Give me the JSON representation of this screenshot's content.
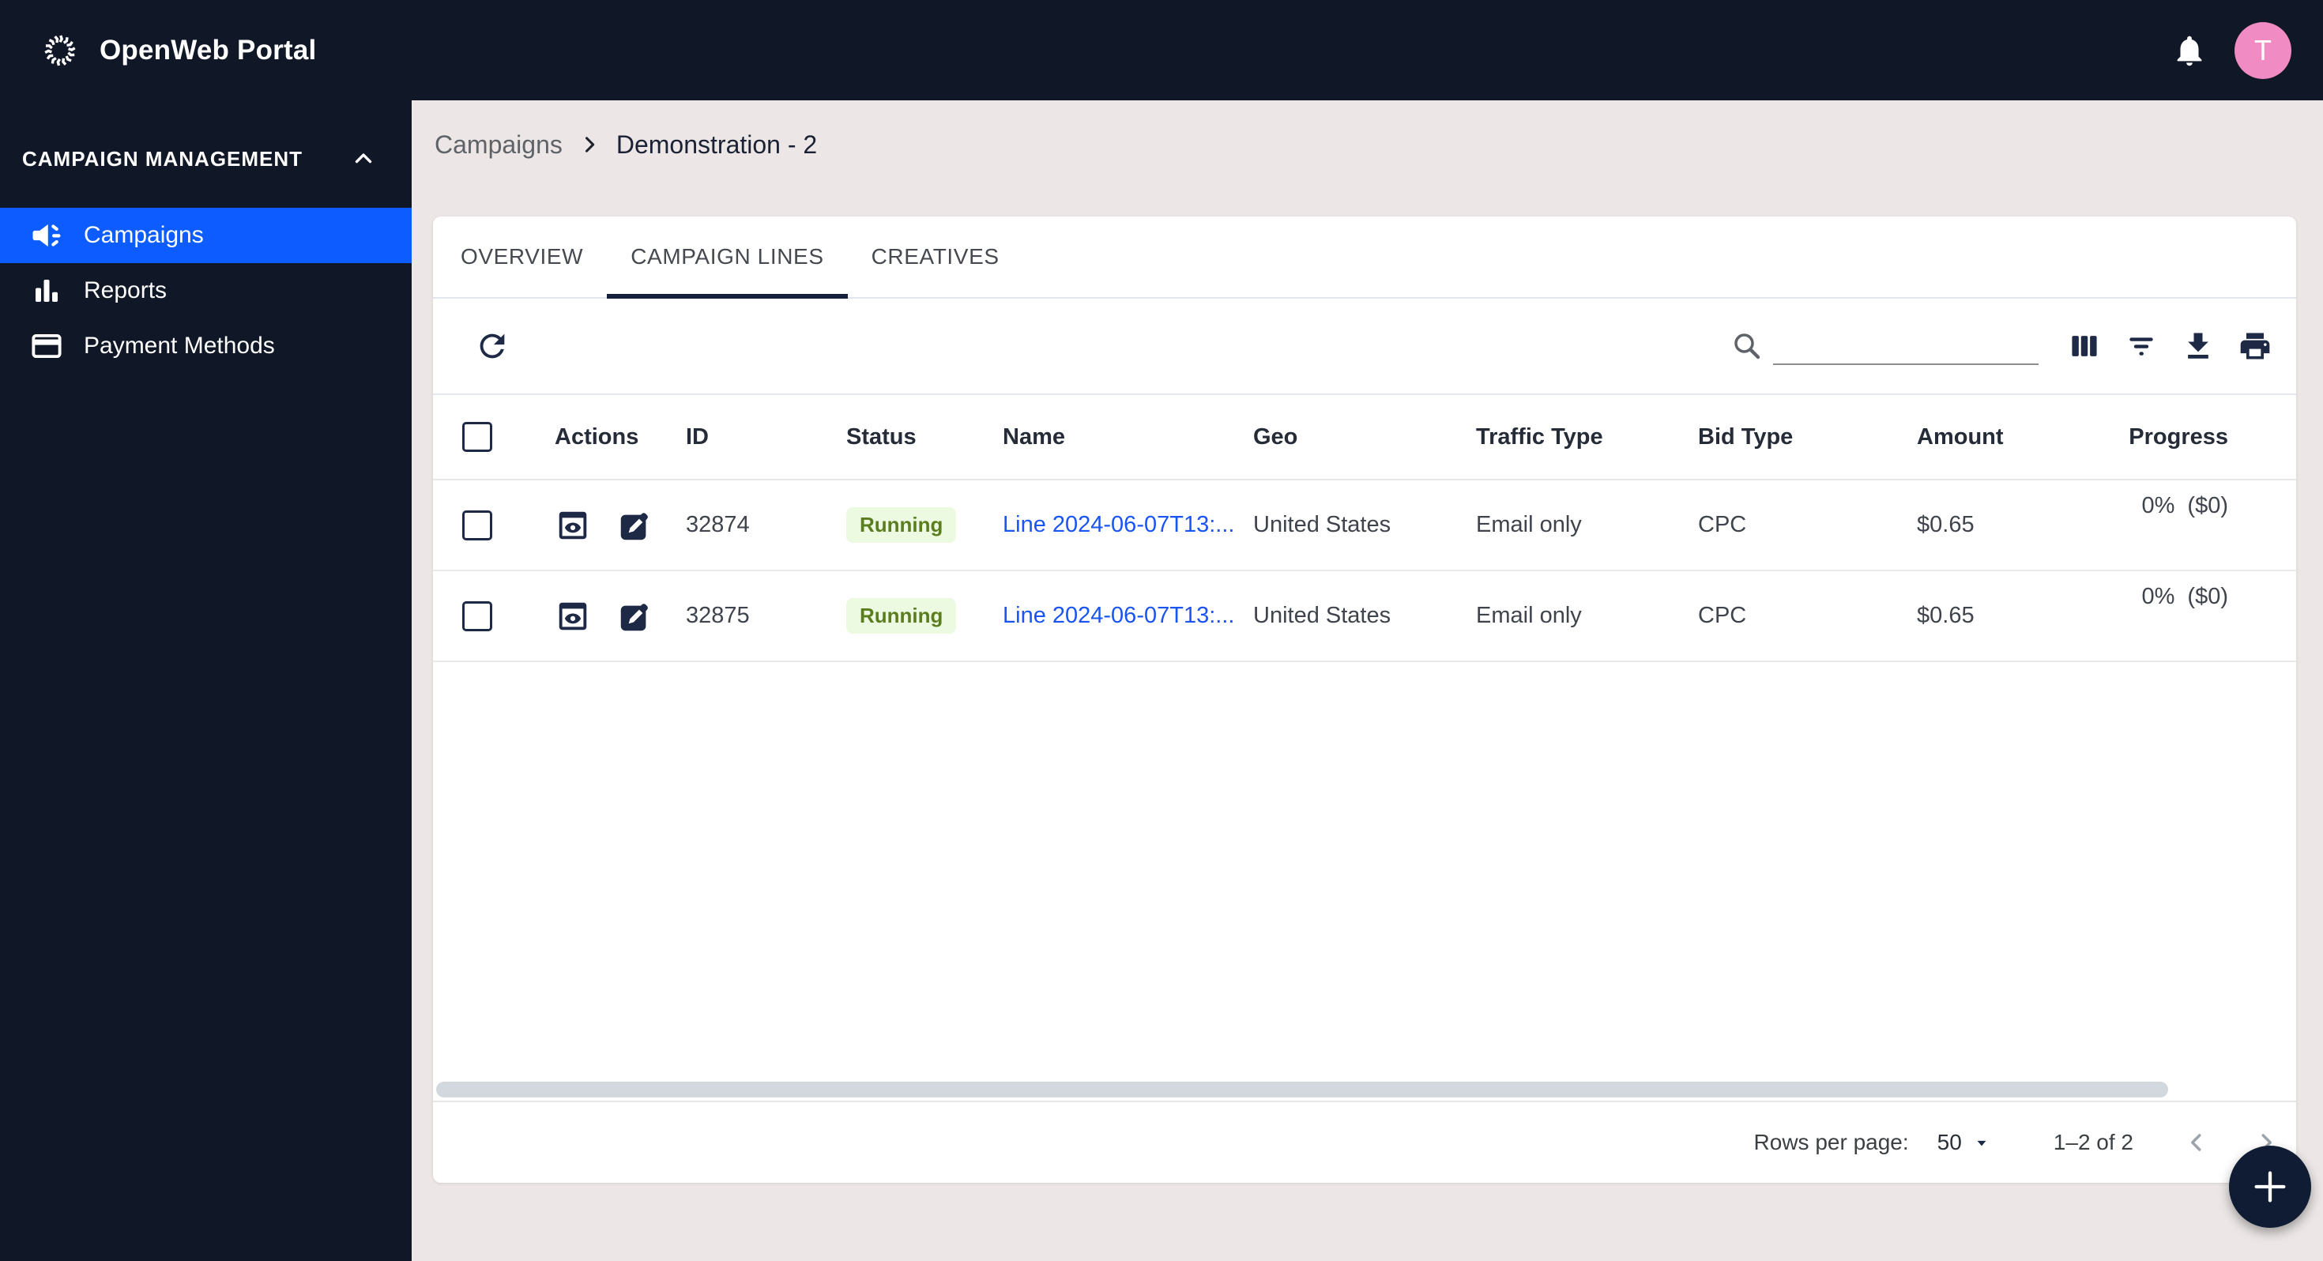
{
  "topbar": {
    "title": "OpenWeb Portal",
    "avatar_initial": "T",
    "icons": [
      "starburst-logo",
      "notifications-bell",
      "user-avatar"
    ]
  },
  "sidebar": {
    "section_label": "CAMPAIGN MANAGEMENT",
    "items": [
      {
        "label": "Campaigns",
        "icon": "megaphone",
        "active": true
      },
      {
        "label": "Reports",
        "icon": "bar-chart",
        "active": false
      },
      {
        "label": "Payment Methods",
        "icon": "credit-card",
        "active": false
      }
    ]
  },
  "breadcrumb": {
    "parent": "Campaigns",
    "current": "Demonstration - 2"
  },
  "tabs": [
    {
      "label": "OVERVIEW",
      "active": false
    },
    {
      "label": "CAMPAIGN LINES",
      "active": true
    },
    {
      "label": "CREATIVES",
      "active": false
    }
  ],
  "toolbar": {
    "icons": [
      "refresh",
      "search",
      "columns",
      "filter",
      "download",
      "print"
    ],
    "search_value": ""
  },
  "table": {
    "columns": [
      "Actions",
      "ID",
      "Status",
      "Name",
      "Geo",
      "Traffic Type",
      "Bid Type",
      "Amount",
      "Progress"
    ],
    "row_action_icons": [
      "preview-eye",
      "edit-pencil"
    ],
    "rows": [
      {
        "id": "32874",
        "status": "Running",
        "name": "Line 2024-06-07T13:...",
        "geo": "United States",
        "traffic_type": "Email only",
        "bid_type": "CPC",
        "amount": "$0.65",
        "progress_pct": "0%",
        "progress_amount": "($0)"
      },
      {
        "id": "32875",
        "status": "Running",
        "name": "Line 2024-06-07T13:...",
        "geo": "United States",
        "traffic_type": "Email only",
        "bid_type": "CPC",
        "amount": "$0.65",
        "progress_pct": "0%",
        "progress_amount": "($0)"
      }
    ]
  },
  "pagination": {
    "rows_per_page_label": "Rows per page:",
    "rows_per_page_value": "50",
    "range_label": "1–2 of 2"
  },
  "fab": {
    "icon": "plus"
  },
  "colors": {
    "topbar_bg": "#101726",
    "sidebar_active_bg": "#0d5cff",
    "link_blue": "#1a54f2",
    "status_green_text": "#5a7d1e",
    "status_green_bg": "#ecfae2",
    "icon_navy": "#1d2945",
    "page_bg": "#ece7e6",
    "avatar_pink": "#f08cc3",
    "fab_bg": "#101c33"
  }
}
